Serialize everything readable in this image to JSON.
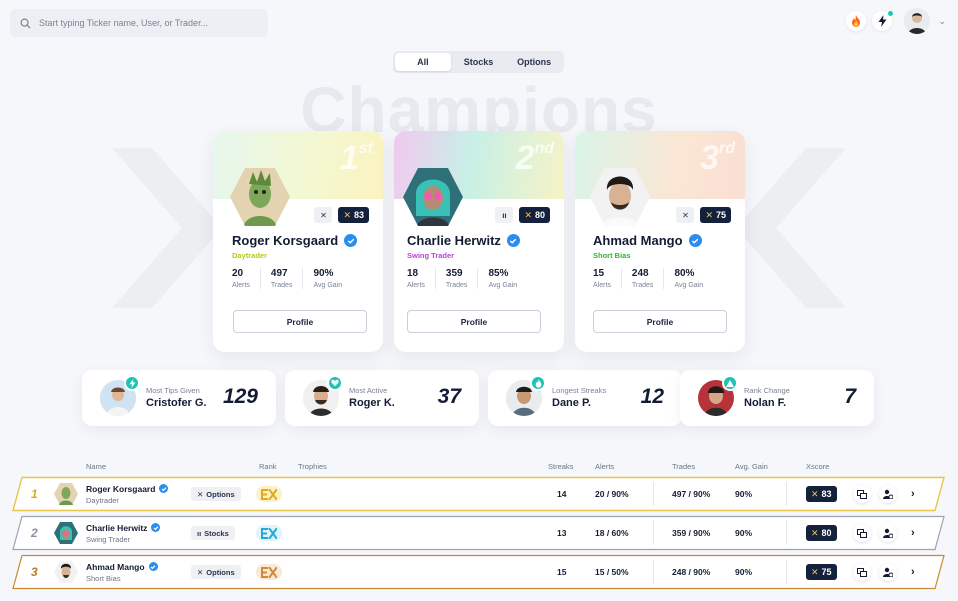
{
  "search": {
    "placeholder": "Start typing Ticker name, User, or Trader..."
  },
  "tabs": [
    {
      "label": "All"
    },
    {
      "label": "Stocks"
    },
    {
      "label": "Options"
    }
  ],
  "background_title": "Champions",
  "podium": [
    {
      "place": "1",
      "suffix": "st",
      "name": "Roger Korsgaard",
      "style": "Daytrader",
      "style_color": "#b8c91a",
      "xscore": "83",
      "badge": "✕",
      "stats": [
        {
          "value": "20",
          "label": "Alerts"
        },
        {
          "value": "497",
          "label": "Trades"
        },
        {
          "value": "90%",
          "label": "Avg Gain"
        }
      ],
      "button": "Profile"
    },
    {
      "place": "2",
      "suffix": "nd",
      "name": "Charlie Herwitz",
      "style": "Swing Trader",
      "style_color": "#c03ed8",
      "xscore": "80",
      "badge": "ıı",
      "stats": [
        {
          "value": "18",
          "label": "Alerts"
        },
        {
          "value": "359",
          "label": "Trades"
        },
        {
          "value": "85%",
          "label": "Avg Gain"
        }
      ],
      "button": "Profile"
    },
    {
      "place": "3",
      "suffix": "rd",
      "name": "Ahmad Mango",
      "style": "Short Bias",
      "style_color": "#2fb52f",
      "xscore": "75",
      "badge": "✕",
      "stats": [
        {
          "value": "15",
          "label": "Alerts"
        },
        {
          "value": "248",
          "label": "Trades"
        },
        {
          "value": "80%",
          "label": "Avg Gain"
        }
      ],
      "button": "Profile"
    }
  ],
  "highlights": [
    {
      "caption": "Most Tips Given",
      "name": "Cristofer G.",
      "value": "129",
      "icon": "bolt-icon"
    },
    {
      "caption": "Most Active",
      "name": "Roger K.",
      "value": "37",
      "icon": "heart-icon"
    },
    {
      "caption": "Longest Streaks",
      "name": "Dane P.",
      "value": "12",
      "icon": "flame-icon"
    },
    {
      "caption": "Rank Change",
      "name": "Nolan F.",
      "value": "7",
      "icon": "triangle-up-icon"
    }
  ],
  "table": {
    "headers": {
      "name": "Name",
      "rank": "Rank",
      "trophies": "Trophies",
      "streaks": "Streaks",
      "alerts": "Alerts",
      "trades": "Trades",
      "avg_gain": "Avg. Gain",
      "xscore": "Xscore"
    },
    "rows": [
      {
        "rank": "1",
        "name": "Roger Korsgaard",
        "style": "Daytrader",
        "market": "Options",
        "market_icon": "✕",
        "streaks": "14",
        "alerts": "20 / 90%",
        "trades": "497 / 90%",
        "avg_gain": "90%",
        "xscore": "83",
        "accent": "#e8c64a"
      },
      {
        "rank": "2",
        "name": "Charlie Herwitz",
        "style": "Swing Trader",
        "market": "Stocks",
        "market_icon": "ıı",
        "streaks": "13",
        "alerts": "18 / 60%",
        "trades": "359 / 90%",
        "avg_gain": "90%",
        "xscore": "80",
        "accent": "#9aa2b3"
      },
      {
        "rank": "3",
        "name": "Ahmad Mango",
        "style": "Short Bias",
        "market": "Options",
        "market_icon": "✕",
        "streaks": "15",
        "alerts": "15 / 50%",
        "trades": "248 / 90%",
        "avg_gain": "90%",
        "xscore": "75",
        "accent": "#c98a36"
      }
    ]
  }
}
